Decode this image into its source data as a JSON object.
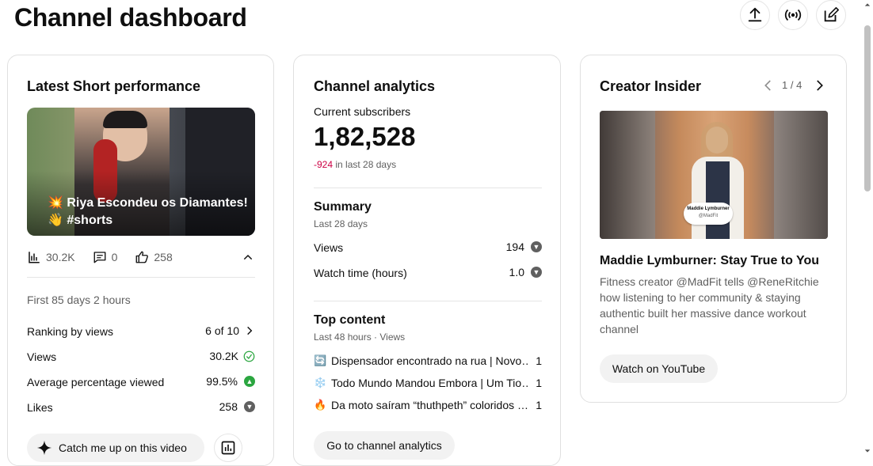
{
  "page": {
    "title": "Channel dashboard"
  },
  "latest_short": {
    "card_title": "Latest Short performance",
    "video_title_line1": "💥 Riya Escondeu os Diamantes!",
    "video_title_line2": "👋 #shorts",
    "views_stat": "30.2K",
    "comments_stat": "0",
    "likes_stat": "258",
    "period": "First 85 days 2 hours",
    "rows": [
      {
        "label": "Ranking by views",
        "value": "6 of 10"
      },
      {
        "label": "Views",
        "value": "30.2K"
      },
      {
        "label": "Average percentage viewed",
        "value": "99.5%"
      },
      {
        "label": "Likes",
        "value": "258"
      }
    ],
    "catch_up_label": "Catch me up on this video"
  },
  "channel_analytics": {
    "card_title": "Channel analytics",
    "subs_label": "Current subscribers",
    "subs_value": "1,82,528",
    "subs_change": "-924",
    "subs_change_suffix": "in last 28 days",
    "summary_title": "Summary",
    "summary_period": "Last 28 days",
    "summary_rows": [
      {
        "label": "Views",
        "value": "194"
      },
      {
        "label": "Watch time (hours)",
        "value": "1.0"
      }
    ],
    "top_content_title": "Top content",
    "top_content_sub": "Last 48 hours · Views",
    "top_items": [
      {
        "emoji": "🔄",
        "title": "Dispensador encontrado na rua | Novo…",
        "views": "1"
      },
      {
        "emoji": "❄️",
        "title": "Todo Mundo Mandou Embora | Um Tio…",
        "views": "1"
      },
      {
        "emoji": "🔥",
        "title": "Da moto saíram “thuthpeth” coloridos …",
        "views": "1"
      }
    ],
    "go_button": "Go to channel analytics"
  },
  "creator_insider": {
    "card_title": "Creator Insider",
    "pager": "1 / 4",
    "thumb_name": "Maddie Lymburner",
    "thumb_handle": "@MadFit",
    "video_title": "Maddie Lymburner: Stay True to You",
    "description": "Fitness creator @MadFit tells @ReneRitchie how listening to her community & staying authentic built her massive dance workout channel",
    "watch_button": "Watch on YouTube"
  },
  "colors": {
    "negative": "#cc0044",
    "green": "#2ba640",
    "grey_icon": "#606060"
  }
}
